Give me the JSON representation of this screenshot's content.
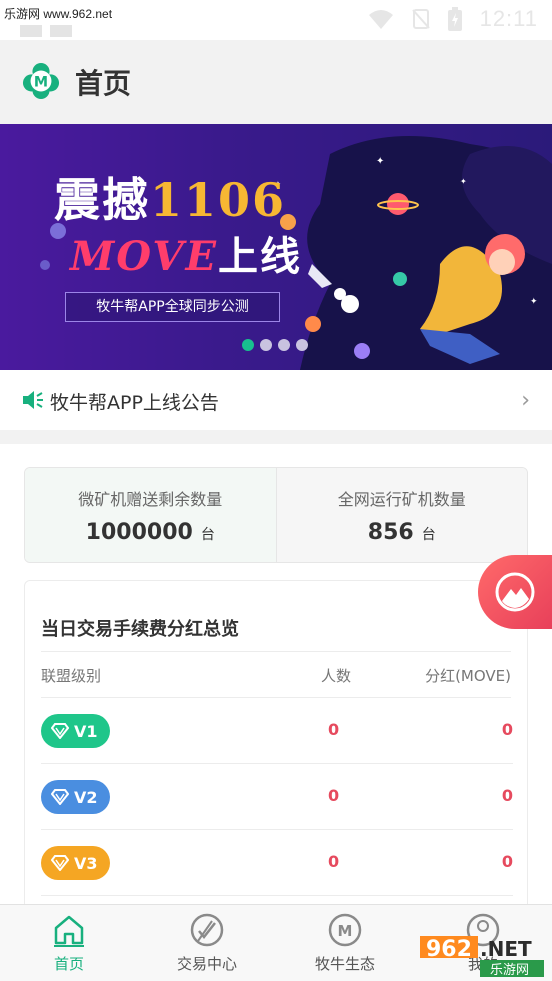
{
  "status_bar": {
    "watermark": "乐游网 www.962.net",
    "time": "12:11"
  },
  "header": {
    "title": "首页"
  },
  "banner": {
    "line1_a": "震撼",
    "line1_b": "1106",
    "line2_a": "MOVE",
    "line2_b": "上线",
    "subtitle": "牧牛帮APP全球同步公测",
    "slide_count": 4,
    "active_slide": 1
  },
  "notice": {
    "text": "牧牛帮APP上线公告"
  },
  "stats": {
    "left": {
      "label": "微矿机赠送剩余数量",
      "value": "1000000",
      "unit": "台"
    },
    "right": {
      "label": "全网运行矿机数量",
      "value": "856",
      "unit": "台"
    }
  },
  "dividend": {
    "title": "当日交易手续费分红总览",
    "headers": {
      "level": "联盟级别",
      "count": "人数",
      "dividend": "分红(MOVE)"
    },
    "rows": [
      {
        "level": "V1",
        "count": "0",
        "dividend": "0",
        "color": "#1fc68a"
      },
      {
        "level": "V2",
        "count": "0",
        "dividend": "0",
        "color": "#4a8ee0"
      },
      {
        "level": "V3",
        "count": "0",
        "dividend": "0",
        "color": "#f5a623"
      }
    ]
  },
  "tabbar": {
    "tabs": [
      {
        "label": "首页",
        "icon": "home-icon",
        "active": true
      },
      {
        "label": "交易中心",
        "icon": "trade-icon",
        "active": false
      },
      {
        "label": "牧牛生态",
        "icon": "ecology-icon",
        "active": false
      },
      {
        "label": "我的",
        "icon": "profile-icon",
        "active": false
      }
    ]
  },
  "watermark_bottom": {
    "text1": "962",
    "text2": ".NET",
    "text3": "乐游网"
  },
  "colors": {
    "accent": "#18b07e",
    "danger": "#e64a5e",
    "banner_bg": "#3a1a8c"
  }
}
